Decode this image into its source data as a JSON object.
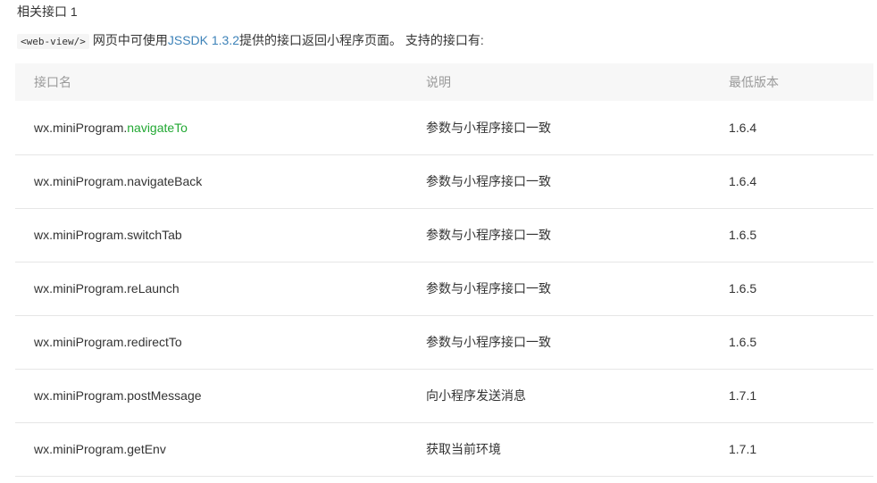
{
  "section": {
    "heading": "相关接口 1"
  },
  "intro": {
    "code": "<web-view/>",
    "text_before_link": "网页中可使用",
    "link_text": "JSSDK 1.3.2",
    "text_after_link": "提供的接口返回小程序页面。 支持的接口有:"
  },
  "table": {
    "headers": [
      "接口名",
      "说明",
      "最低版本"
    ],
    "rows": [
      {
        "name_prefix": "wx.miniProgram.",
        "name_method": "navigateTo",
        "desc": "参数与小程序接口一致",
        "version": "1.6.4"
      },
      {
        "name_prefix": "wx.miniProgram.",
        "name_method": "navigateBack",
        "desc": "参数与小程序接口一致",
        "version": "1.6.4"
      },
      {
        "name_prefix": "wx.miniProgram.",
        "name_method": "switchTab",
        "desc": "参数与小程序接口一致",
        "version": "1.6.5"
      },
      {
        "name_prefix": "wx.miniProgram.",
        "name_method": "reLaunch",
        "desc": "参数与小程序接口一致",
        "version": "1.6.5"
      },
      {
        "name_prefix": "wx.miniProgram.",
        "name_method": "redirectTo",
        "desc": "参数与小程序接口一致",
        "version": "1.6.5"
      },
      {
        "name_prefix": "wx.miniProgram.",
        "name_method": "postMessage",
        "desc": "向小程序发送消息",
        "version": "1.7.1"
      },
      {
        "name_prefix": "wx.miniProgram.",
        "name_method": "getEnv",
        "desc": "获取当前环境",
        "version": "1.7.1"
      }
    ]
  },
  "colors": {
    "link": "#3d82b8",
    "highlight_green": "#22a833",
    "header_bg": "#f7f7f7",
    "header_text": "#9a9a9a"
  }
}
